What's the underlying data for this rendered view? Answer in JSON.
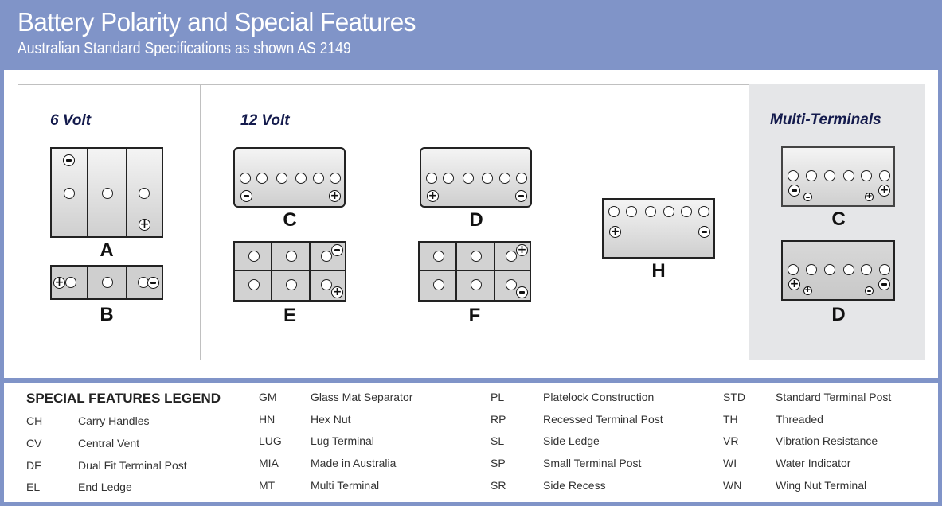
{
  "header": {
    "title": "Battery Polarity and Special Features",
    "subtitle": "Australian Standard Specifications as shown AS 2149"
  },
  "colors": {
    "header_bg": "#8094c8",
    "section_title": "#141b4d",
    "multi_panel_bg": "#e5e6e8"
  },
  "sections": {
    "six_volt": {
      "title": "6 Volt"
    },
    "twelve_volt": {
      "title": "12 Volt"
    },
    "multi": {
      "title": "Multi-Terminals"
    }
  },
  "batteries": {
    "A": {
      "label": "A",
      "group": "6 Volt",
      "negative": "top-left",
      "positive": "bottom-right"
    },
    "B": {
      "label": "B",
      "group": "6 Volt",
      "positive": "left",
      "negative": "right"
    },
    "C": {
      "label": "C",
      "group": "12 Volt",
      "negative": "left",
      "positive": "right"
    },
    "D": {
      "label": "D",
      "group": "12 Volt",
      "positive": "left",
      "negative": "right"
    },
    "E": {
      "label": "E",
      "group": "12 Volt",
      "negative": "top-right",
      "positive": "bottom-right"
    },
    "F": {
      "label": "F",
      "group": "12 Volt",
      "positive": "top-right",
      "negative": "bottom-right"
    },
    "H": {
      "label": "H",
      "group": "12 Volt",
      "positive": "left",
      "negative": "right"
    },
    "MC": {
      "label": "C",
      "group": "Multi-Terminals",
      "negative": "left (large + small)",
      "positive": "right (large + small)"
    },
    "MD": {
      "label": "D",
      "group": "Multi-Terminals",
      "positive": "left (large + small)",
      "negative": "right (large + small)"
    }
  },
  "legend": {
    "title": "SPECIAL FEATURES LEGEND",
    "columns": [
      [
        {
          "code": "CH",
          "desc": "Carry Handles"
        },
        {
          "code": "CV",
          "desc": "Central Vent"
        },
        {
          "code": "DF",
          "desc": "Dual Fit Terminal Post"
        },
        {
          "code": "EL",
          "desc": "End Ledge"
        }
      ],
      [
        {
          "code": "GM",
          "desc": "Glass Mat Separator"
        },
        {
          "code": "HN",
          "desc": "Hex Nut"
        },
        {
          "code": "LUG",
          "desc": "Lug Terminal"
        },
        {
          "code": "MIA",
          "desc": "Made in Australia"
        },
        {
          "code": "MT",
          "desc": "Multi Terminal"
        }
      ],
      [
        {
          "code": "PL",
          "desc": "Platelock Construction"
        },
        {
          "code": "RP",
          "desc": "Recessed Terminal Post"
        },
        {
          "code": "SL",
          "desc": "Side Ledge"
        },
        {
          "code": "SP",
          "desc": "Small Terminal Post"
        },
        {
          "code": "SR",
          "desc": "Side Recess"
        }
      ],
      [
        {
          "code": "STD",
          "desc": "Standard Terminal Post"
        },
        {
          "code": "TH",
          "desc": "Threaded"
        },
        {
          "code": "VR",
          "desc": "Vibration Resistance"
        },
        {
          "code": "WI",
          "desc": "Water Indicator"
        },
        {
          "code": "WN",
          "desc": "Wing Nut Terminal"
        }
      ]
    ]
  }
}
